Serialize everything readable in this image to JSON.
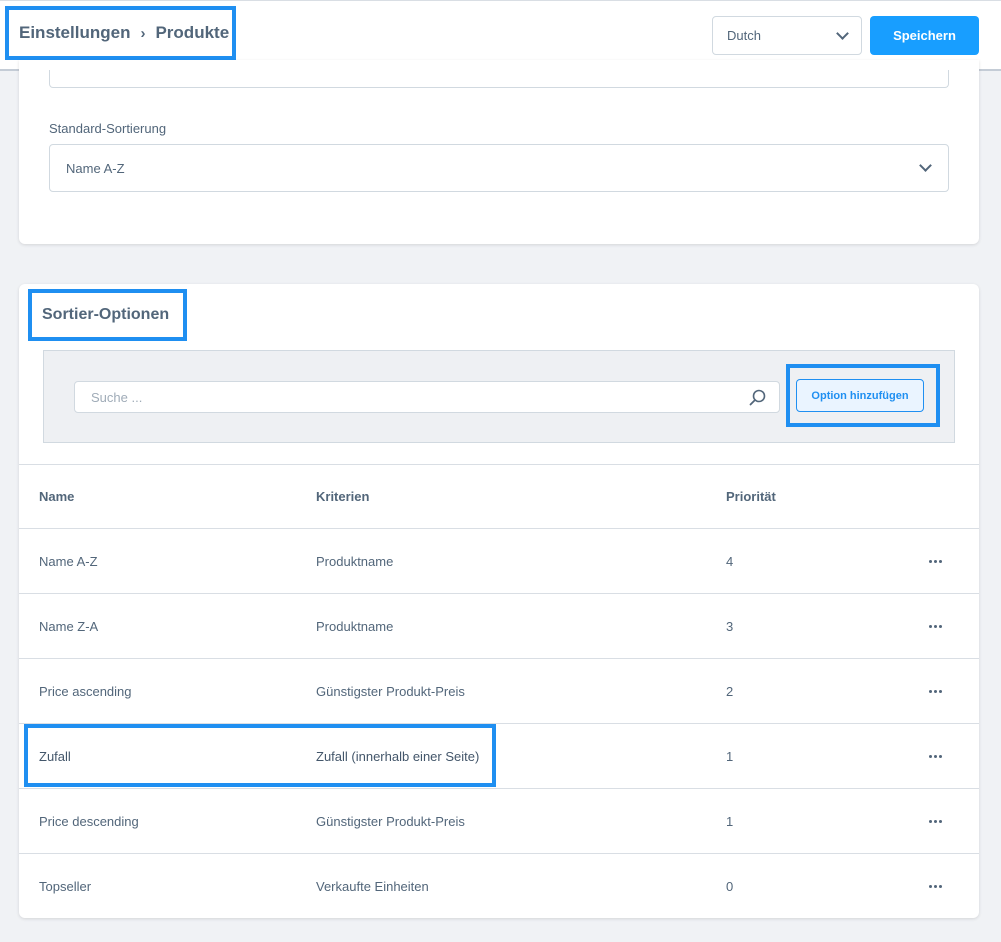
{
  "header": {
    "breadcrumb": [
      "Einstellungen",
      "Produkte"
    ],
    "language_select": "Dutch",
    "save_label": "Speichern"
  },
  "settings": {
    "default_sort_label": "Standard-Sortierung",
    "default_sort_value": "Name A-Z"
  },
  "sort_options": {
    "title": "Sortier-Optionen",
    "search_placeholder": "Suche ...",
    "add_label": "Option hinzufügen",
    "columns": [
      "Name",
      "Kriterien",
      "Priorität"
    ],
    "rows": [
      {
        "name": "Name A-Z",
        "criteria": "Produktname",
        "priority": "4"
      },
      {
        "name": "Name Z-A",
        "criteria": "Produktname",
        "priority": "3"
      },
      {
        "name": "Price ascending",
        "criteria": "Günstigster Produkt-Preis",
        "priority": "2"
      },
      {
        "name": "Zufall",
        "criteria": "Zufall (innerhalb einer Seite)",
        "priority": "1"
      },
      {
        "name": "Price descending",
        "criteria": "Günstigster Produkt-Preis",
        "priority": "1"
      },
      {
        "name": "Topseller",
        "criteria": "Verkaufte Einheiten",
        "priority": "0"
      }
    ]
  },
  "icons": [
    "chevron-down-icon",
    "search-icon",
    "more-actions-icon",
    "breadcrumb-chevron-icon"
  ],
  "colors": {
    "accent": "#189eff",
    "highlight": "#1f8ff1",
    "text": "#52667a"
  }
}
